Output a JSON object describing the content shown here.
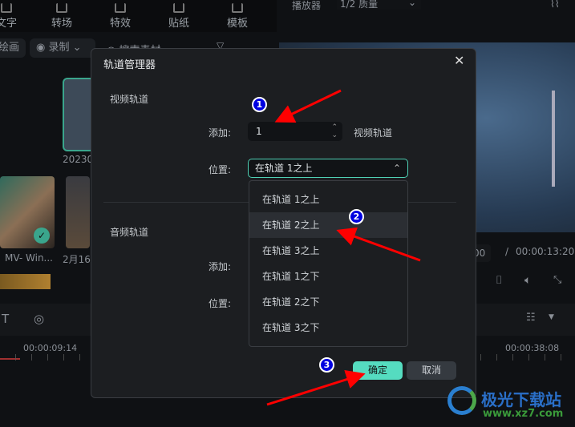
{
  "toolbar": {
    "items": [
      "文字",
      "转场",
      "特效",
      "贴纸",
      "模板"
    ]
  },
  "media_bar": {
    "draw": "绘画",
    "record": "录制",
    "search_placeholder": "搜索素材"
  },
  "player": {
    "label": "播放器",
    "quality": "1/2 质量",
    "current_time": "00",
    "separator": "/",
    "total_time": "00:00:13:20"
  },
  "media": {
    "items": [
      "20230",
      "MV- Win...",
      "2月16"
    ]
  },
  "timeline": {
    "timecodes": [
      "00:00:09:14",
      "00:00:38:08"
    ]
  },
  "dialog": {
    "title": "轨道管理器",
    "video_section": "视频轨道",
    "audio_section": "音频轨道",
    "add_label": "添加:",
    "position_label": "位置:",
    "video_add_value": "1",
    "video_unit": "视频轨道",
    "video_position_value": "在轨道 1之上",
    "dropdown_options": [
      "在轨道 1之上",
      "在轨道 2之上",
      "在轨道 3之上",
      "在轨道 1之下",
      "在轨道 2之下",
      "在轨道 3之下"
    ],
    "highlighted_option": "在轨道 2之上",
    "ok": "确定",
    "cancel": "取消"
  },
  "annotations": [
    "1",
    "2",
    "3"
  ],
  "watermark": {
    "name": "极光下载站",
    "url": "www.xz7.com"
  },
  "colors": {
    "accent": "#55dcc0",
    "annotation_arrow": "#ff0000",
    "annotation_circle": "#0000e0"
  }
}
